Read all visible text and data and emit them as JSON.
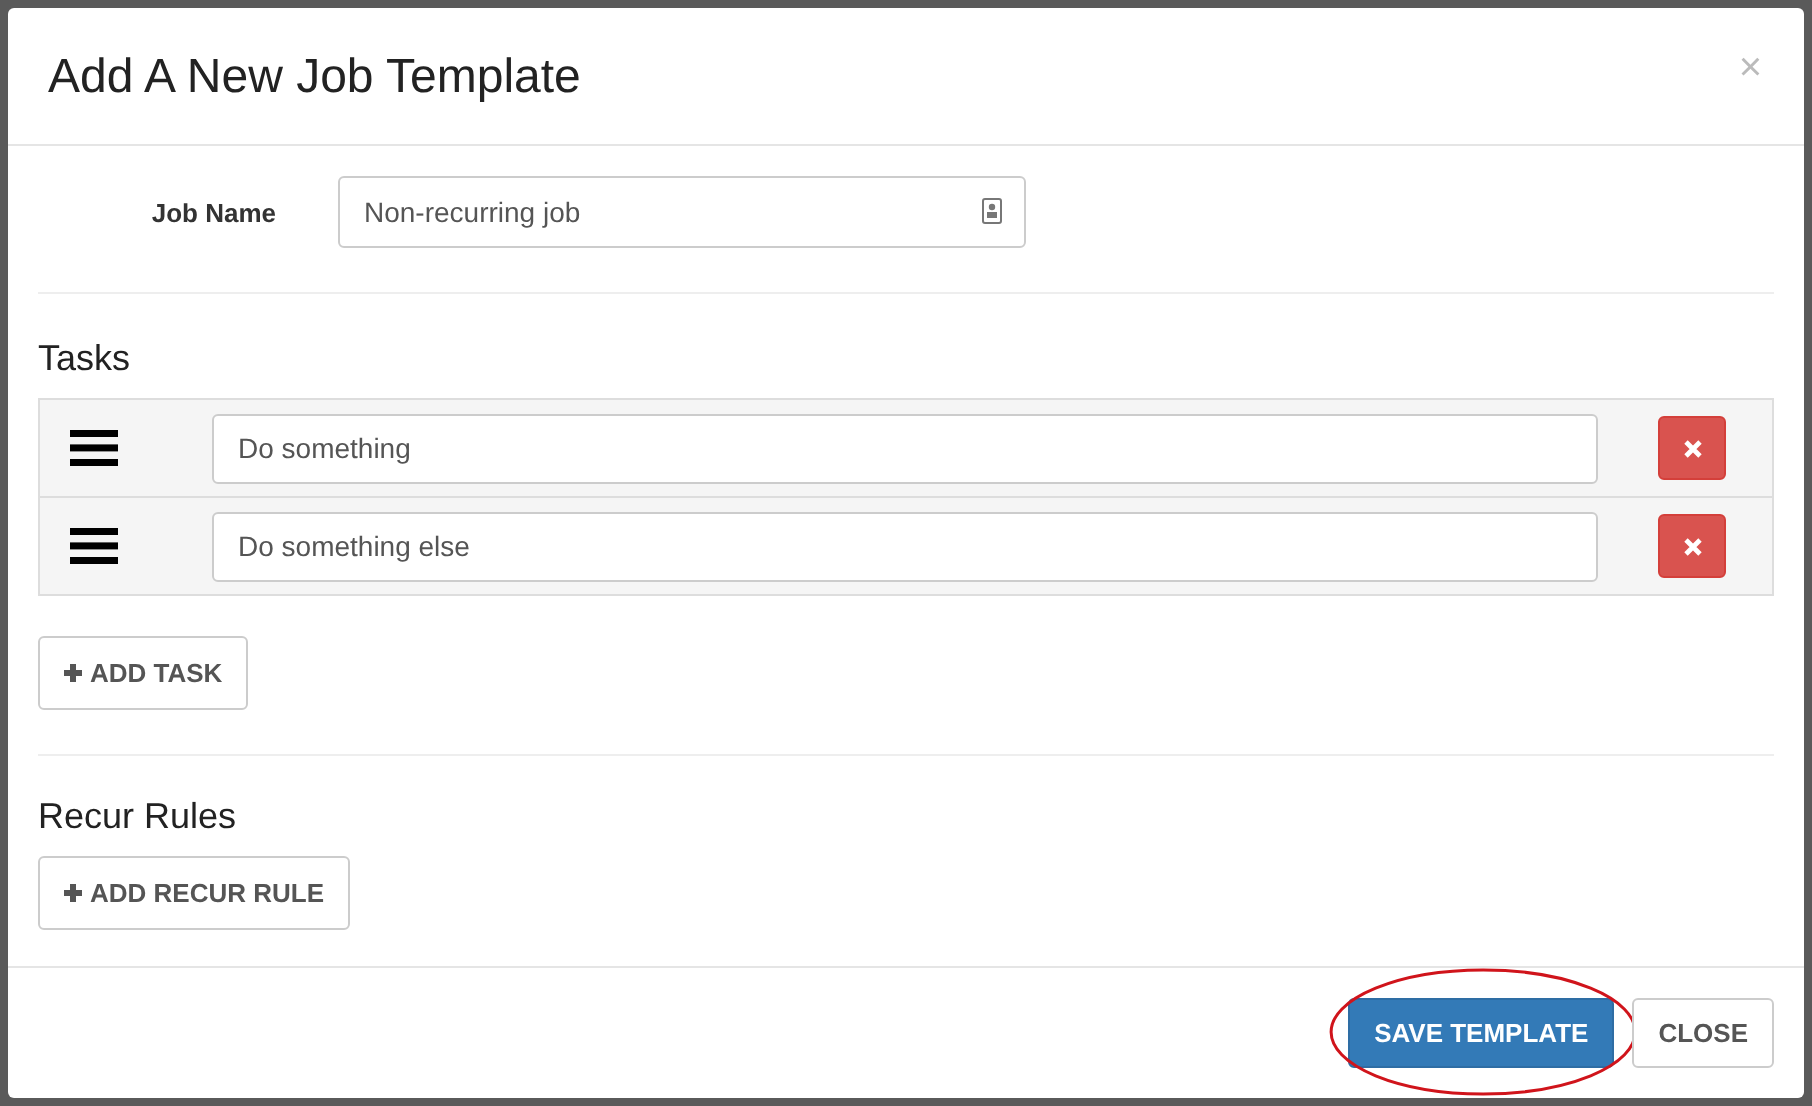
{
  "dialog": {
    "title": "Add A New Job Template",
    "close_icon": "×"
  },
  "job_name": {
    "label": "Job Name",
    "value": "Non-recurring job"
  },
  "tasks": {
    "heading": "Tasks",
    "items": [
      {
        "value": "Do something"
      },
      {
        "value": "Do something else"
      }
    ],
    "add_button": "ADD TASK"
  },
  "recur_rules": {
    "heading": "Recur Rules",
    "add_button": "ADD RECUR RULE"
  },
  "footer_buttons": [
    {
      "label": "SAVE TEMPLATE",
      "kind": "primary",
      "highlighted": true
    },
    {
      "label": "CLOSE",
      "kind": "default",
      "highlighted": false
    }
  ]
}
